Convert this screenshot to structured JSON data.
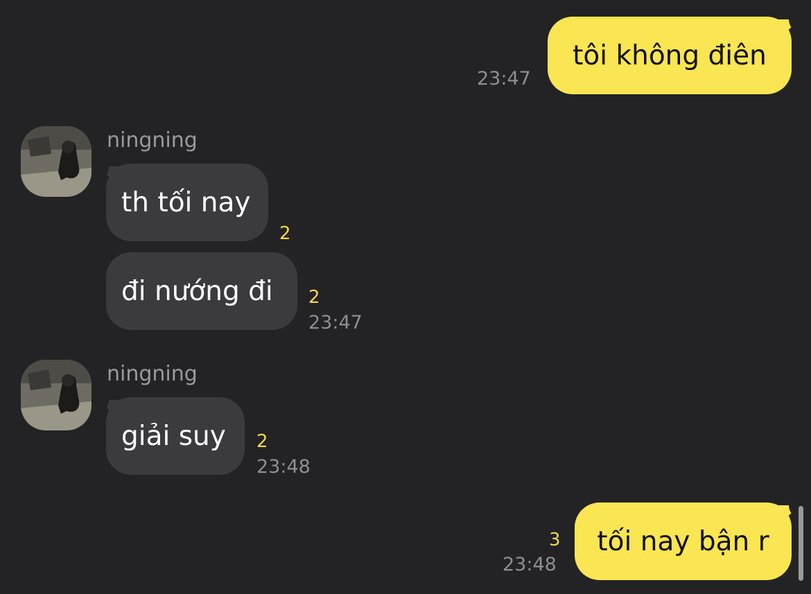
{
  "messages": [
    {
      "type": "outgoing",
      "text": "tôi không điên",
      "time": "23:47"
    },
    {
      "type": "incoming",
      "sender": "ningning",
      "text": "th tối nay",
      "unread": "2"
    },
    {
      "type": "incoming",
      "text": "đi nướng đi",
      "unread": "2",
      "time": "23:47"
    },
    {
      "type": "incoming",
      "sender": "ningning",
      "text": "giải suy",
      "unread": "2",
      "time": "23:48"
    },
    {
      "type": "outgoing",
      "text": "tối nay bận r",
      "unread": "3",
      "time": "23:48"
    }
  ],
  "colors": {
    "background": "#232325",
    "outgoing_bubble": "#fae552",
    "incoming_bubble": "#3b3b3d",
    "unread_count": "#f5d94a",
    "timestamp": "#8e8e93"
  }
}
